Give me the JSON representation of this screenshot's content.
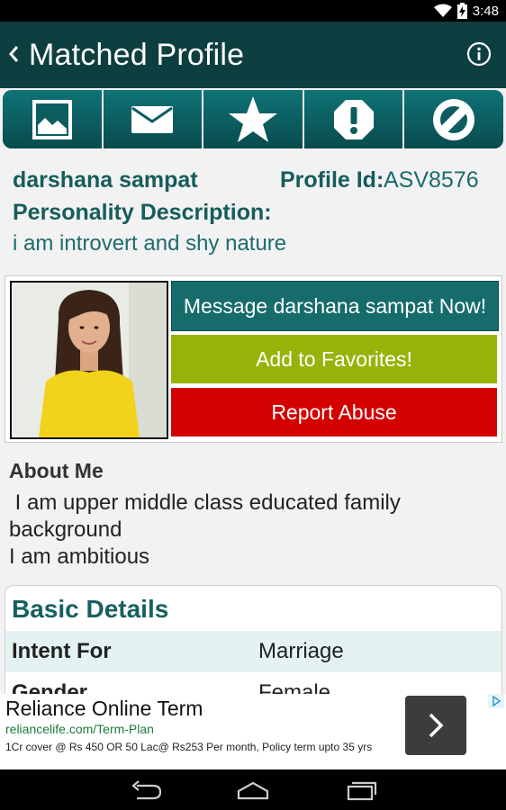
{
  "status_bar": {
    "time": "3:48",
    "icons": [
      "wifi-icon",
      "battery-charging-icon"
    ]
  },
  "action_bar": {
    "title": "Matched Profile",
    "icons": [
      "back-chevron-icon",
      "info-icon"
    ]
  },
  "toolbar": {
    "buttons": [
      "photo-icon",
      "mail-icon",
      "star-icon",
      "alert-icon",
      "block-icon"
    ]
  },
  "profile": {
    "name": "darshana sampat",
    "profile_id_label": "Profile Id:",
    "profile_id": "ASV8576",
    "personality_label": "Personality Description:",
    "personality": "i am introvert and shy nature"
  },
  "actions": {
    "message": "Message darshana sampat Now!",
    "favorite": "Add to Favorites!",
    "report": "Report Abuse",
    "colors": {
      "message": "#166b6b",
      "favorite": "#97b30a",
      "report": "#d40000"
    }
  },
  "about": {
    "heading": "About Me",
    "lines": [
      " I am upper middle class educated family",
      "background",
      "I am ambitious"
    ]
  },
  "basic_details": {
    "heading": "Basic Details",
    "rows": [
      {
        "key": "Intent For",
        "value": "Marriage"
      },
      {
        "key": "Gender",
        "value": "Female"
      }
    ]
  },
  "ad": {
    "title": "Reliance Online Term",
    "url": "reliancelife.com/Term-Plan",
    "description": "1Cr cover @ Rs 450 OR 50 Lac@ Rs253 Per month, Policy term upto 35 yrs"
  },
  "nav_bar": {
    "icons": [
      "back-icon",
      "home-icon",
      "recents-icon"
    ]
  },
  "theme": {
    "action_bar": "#0e3f40",
    "accent": "#166060"
  }
}
